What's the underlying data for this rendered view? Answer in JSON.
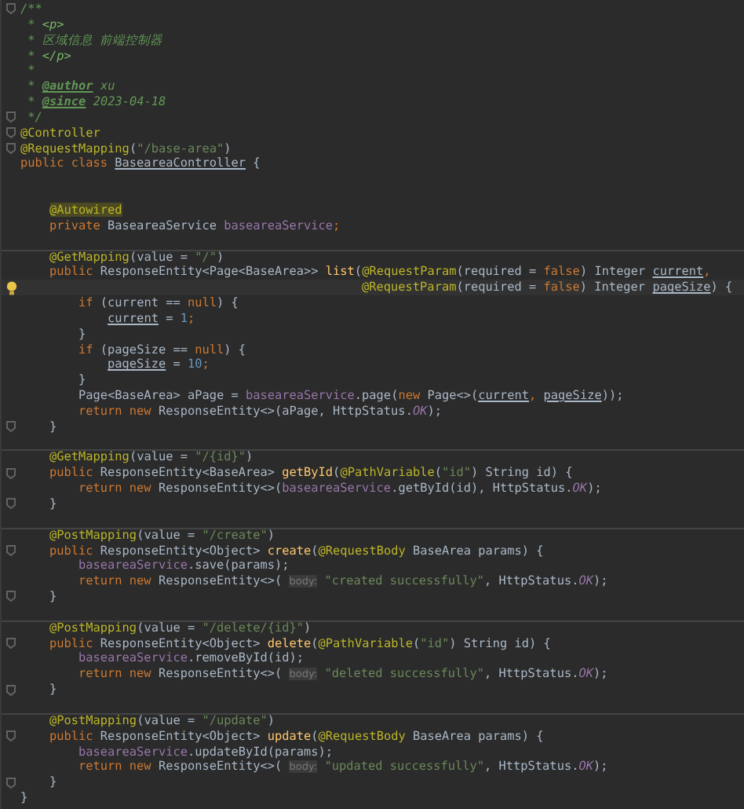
{
  "editor": {
    "lines": [
      {
        "kind": "code",
        "fold_marker": true,
        "tokens": [
          {
            "kind": "doc",
            "text": "/**"
          }
        ]
      },
      {
        "kind": "code",
        "tokens": [
          {
            "kind": "doc",
            "text": " * "
          },
          {
            "kind": "doc-html",
            "text": "<p>"
          }
        ]
      },
      {
        "kind": "code",
        "tokens": [
          {
            "kind": "doc",
            "text": " * 区域信息 前端控制器"
          }
        ]
      },
      {
        "kind": "code",
        "tokens": [
          {
            "kind": "doc",
            "text": " * "
          },
          {
            "kind": "doc-html",
            "text": "</p>"
          }
        ]
      },
      {
        "kind": "code",
        "tokens": [
          {
            "kind": "doc",
            "text": " *"
          }
        ]
      },
      {
        "kind": "code",
        "tokens": [
          {
            "kind": "doc",
            "text": " * "
          },
          {
            "kind": "doc-tag",
            "text": "@author"
          },
          {
            "kind": "doc",
            "text": " xu"
          }
        ]
      },
      {
        "kind": "code",
        "tokens": [
          {
            "kind": "doc",
            "text": " * "
          },
          {
            "kind": "doc-tag",
            "text": "@since"
          },
          {
            "kind": "doc",
            "text": " 2023-04-18"
          }
        ]
      },
      {
        "kind": "code",
        "fold_marker": true,
        "tokens": [
          {
            "kind": "doc",
            "text": " */"
          }
        ]
      },
      {
        "kind": "code",
        "fold_marker": true,
        "tokens": [
          {
            "kind": "ann",
            "text": "@Controller"
          }
        ]
      },
      {
        "kind": "code",
        "fold_marker": true,
        "tokens": [
          {
            "kind": "ann",
            "text": "@RequestMapping"
          },
          {
            "kind": "plain",
            "text": "("
          },
          {
            "kind": "str",
            "text": "\"/base-area\""
          },
          {
            "kind": "plain",
            "text": ")"
          }
        ]
      },
      {
        "kind": "code",
        "tokens": [
          {
            "kind": "kw",
            "text": "public class "
          },
          {
            "kind": "under",
            "text": "BaseareaController"
          },
          {
            "kind": "plain",
            "text": " {"
          }
        ]
      },
      {
        "kind": "blank"
      },
      {
        "kind": "blank"
      },
      {
        "kind": "code",
        "tokens": [
          {
            "kind": "ann-marked",
            "text": "    @Autowired"
          }
        ]
      },
      {
        "kind": "code",
        "tokens": [
          {
            "kind": "kw",
            "text": "    private "
          },
          {
            "kind": "plain",
            "text": "BaseareaService "
          },
          {
            "kind": "field",
            "text": "baseareaService"
          },
          {
            "kind": "kw",
            "text": ";"
          }
        ]
      },
      {
        "kind": "blank"
      },
      {
        "kind": "code",
        "separator": true,
        "tokens": [
          {
            "kind": "ann",
            "text": "    @GetMapping"
          },
          {
            "kind": "plain",
            "text": "(value = "
          },
          {
            "kind": "str",
            "text": "\"/\""
          },
          {
            "kind": "plain",
            "text": ")"
          }
        ]
      },
      {
        "kind": "code",
        "tokens": [
          {
            "kind": "kw",
            "text": "    public "
          },
          {
            "kind": "plain",
            "text": "ResponseEntity<Page<BaseArea>> "
          },
          {
            "kind": "method",
            "text": "list"
          },
          {
            "kind": "plain",
            "text": "("
          },
          {
            "kind": "ann",
            "text": "@RequestParam"
          },
          {
            "kind": "plain",
            "text": "(required = "
          },
          {
            "kind": "kw",
            "text": "false"
          },
          {
            "kind": "plain",
            "text": ") Integer "
          },
          {
            "kind": "under",
            "text": "current"
          },
          {
            "kind": "kw",
            "text": ","
          }
        ]
      },
      {
        "kind": "code",
        "bulb": true,
        "highlighted": true,
        "tokens": [
          {
            "kind": "ann",
            "text": "                                               @RequestParam"
          },
          {
            "kind": "plain",
            "text": "(required = "
          },
          {
            "kind": "kw",
            "text": "false"
          },
          {
            "kind": "plain",
            "text": ") Integer "
          },
          {
            "kind": "under",
            "text": "pageSize"
          },
          {
            "kind": "plain",
            "text": ") {"
          }
        ]
      },
      {
        "kind": "code",
        "tokens": [
          {
            "kind": "kw",
            "text": "        if "
          },
          {
            "kind": "plain",
            "text": "(current == "
          },
          {
            "kind": "kw",
            "text": "null"
          },
          {
            "kind": "plain",
            "text": ") {"
          }
        ]
      },
      {
        "kind": "code",
        "tokens": [
          {
            "kind": "under",
            "text": "            current"
          },
          {
            "kind": "plain",
            "text": " = "
          },
          {
            "kind": "num",
            "text": "1"
          },
          {
            "kind": "kw",
            "text": ";"
          }
        ]
      },
      {
        "kind": "code",
        "tokens": [
          {
            "kind": "plain",
            "text": "        }"
          }
        ]
      },
      {
        "kind": "code",
        "tokens": [
          {
            "kind": "kw",
            "text": "        if "
          },
          {
            "kind": "plain",
            "text": "(pageSize == "
          },
          {
            "kind": "kw",
            "text": "null"
          },
          {
            "kind": "plain",
            "text": ") {"
          }
        ]
      },
      {
        "kind": "code",
        "tokens": [
          {
            "kind": "under",
            "text": "            pageSize"
          },
          {
            "kind": "plain",
            "text": " = "
          },
          {
            "kind": "num",
            "text": "10"
          },
          {
            "kind": "kw",
            "text": ";"
          }
        ]
      },
      {
        "kind": "code",
        "tokens": [
          {
            "kind": "plain",
            "text": "        }"
          }
        ]
      },
      {
        "kind": "code",
        "tokens": [
          {
            "kind": "plain",
            "text": "        Page<BaseArea> aPage = "
          },
          {
            "kind": "field",
            "text": "baseareaService"
          },
          {
            "kind": "plain",
            "text": ".page("
          },
          {
            "kind": "kw",
            "text": "new "
          },
          {
            "kind": "plain",
            "text": "Page<>("
          },
          {
            "kind": "under",
            "text": "current"
          },
          {
            "kind": "kw",
            "text": ", "
          },
          {
            "kind": "under",
            "text": "pageSize"
          },
          {
            "kind": "plain",
            "text": "));"
          }
        ]
      },
      {
        "kind": "code",
        "tokens": [
          {
            "kind": "kw",
            "text": "        return new "
          },
          {
            "kind": "plain",
            "text": "ResponseEntity<>(aPage, HttpStatus."
          },
          {
            "kind": "static",
            "text": "OK"
          },
          {
            "kind": "plain",
            "text": ");"
          }
        ]
      },
      {
        "kind": "code",
        "fold_marker": true,
        "tokens": [
          {
            "kind": "plain",
            "text": "    }"
          }
        ]
      },
      {
        "kind": "blank"
      },
      {
        "kind": "code",
        "separator": true,
        "tokens": [
          {
            "kind": "ann",
            "text": "    @GetMapping"
          },
          {
            "kind": "plain",
            "text": "(value = "
          },
          {
            "kind": "str",
            "text": "\"/{id}\""
          },
          {
            "kind": "plain",
            "text": ")"
          }
        ]
      },
      {
        "kind": "code",
        "fold_marker": true,
        "tokens": [
          {
            "kind": "kw",
            "text": "    public "
          },
          {
            "kind": "plain",
            "text": "ResponseEntity<BaseArea> "
          },
          {
            "kind": "method",
            "text": "getById"
          },
          {
            "kind": "plain",
            "text": "("
          },
          {
            "kind": "ann",
            "text": "@PathVariable"
          },
          {
            "kind": "plain",
            "text": "("
          },
          {
            "kind": "str",
            "text": "\"id\""
          },
          {
            "kind": "plain",
            "text": ") String id) {"
          }
        ]
      },
      {
        "kind": "code",
        "tokens": [
          {
            "kind": "kw",
            "text": "        return new "
          },
          {
            "kind": "plain",
            "text": "ResponseEntity<>("
          },
          {
            "kind": "field",
            "text": "baseareaService"
          },
          {
            "kind": "plain",
            "text": ".getById(id), HttpStatus."
          },
          {
            "kind": "static",
            "text": "OK"
          },
          {
            "kind": "plain",
            "text": ");"
          }
        ]
      },
      {
        "kind": "code",
        "fold_marker": true,
        "tokens": [
          {
            "kind": "plain",
            "text": "    }"
          }
        ]
      },
      {
        "kind": "blank"
      },
      {
        "kind": "code",
        "separator": true,
        "tokens": [
          {
            "kind": "ann",
            "text": "    @PostMapping"
          },
          {
            "kind": "plain",
            "text": "(value = "
          },
          {
            "kind": "str",
            "text": "\"/create\""
          },
          {
            "kind": "plain",
            "text": ")"
          }
        ]
      },
      {
        "kind": "code",
        "fold_marker": true,
        "tokens": [
          {
            "kind": "kw",
            "text": "    public "
          },
          {
            "kind": "plain",
            "text": "ResponseEntity<Object> "
          },
          {
            "kind": "method",
            "text": "create"
          },
          {
            "kind": "plain",
            "text": "("
          },
          {
            "kind": "ann",
            "text": "@RequestBody"
          },
          {
            "kind": "plain",
            "text": " BaseArea params) {"
          }
        ]
      },
      {
        "kind": "code",
        "tokens": [
          {
            "kind": "field",
            "text": "        baseareaService"
          },
          {
            "kind": "plain",
            "text": ".save(params);"
          }
        ]
      },
      {
        "kind": "code",
        "tokens": [
          {
            "kind": "kw",
            "text": "        return new "
          },
          {
            "kind": "plain",
            "text": "ResponseEntity<>( "
          },
          {
            "kind": "hint",
            "text": "body:"
          },
          {
            "kind": "str",
            "text": " \"created successfully\""
          },
          {
            "kind": "plain",
            "text": ", HttpStatus."
          },
          {
            "kind": "static",
            "text": "OK"
          },
          {
            "kind": "plain",
            "text": ");"
          }
        ]
      },
      {
        "kind": "code",
        "fold_marker": true,
        "tokens": [
          {
            "kind": "plain",
            "text": "    }"
          }
        ]
      },
      {
        "kind": "blank"
      },
      {
        "kind": "code",
        "separator": true,
        "tokens": [
          {
            "kind": "ann",
            "text": "    @PostMapping"
          },
          {
            "kind": "plain",
            "text": "(value = "
          },
          {
            "kind": "str",
            "text": "\"/delete/{id}\""
          },
          {
            "kind": "plain",
            "text": ")"
          }
        ]
      },
      {
        "kind": "code",
        "fold_marker": true,
        "tokens": [
          {
            "kind": "kw",
            "text": "    public "
          },
          {
            "kind": "plain",
            "text": "ResponseEntity<Object> "
          },
          {
            "kind": "method",
            "text": "delete"
          },
          {
            "kind": "plain",
            "text": "("
          },
          {
            "kind": "ann",
            "text": "@PathVariable"
          },
          {
            "kind": "plain",
            "text": "("
          },
          {
            "kind": "str",
            "text": "\"id\""
          },
          {
            "kind": "plain",
            "text": ") String id) {"
          }
        ]
      },
      {
        "kind": "code",
        "tokens": [
          {
            "kind": "field",
            "text": "        baseareaService"
          },
          {
            "kind": "plain",
            "text": ".removeById(id);"
          }
        ]
      },
      {
        "kind": "code",
        "tokens": [
          {
            "kind": "kw",
            "text": "        return new "
          },
          {
            "kind": "plain",
            "text": "ResponseEntity<>( "
          },
          {
            "kind": "hint",
            "text": "body:"
          },
          {
            "kind": "str",
            "text": " \"deleted successfully\""
          },
          {
            "kind": "plain",
            "text": ", HttpStatus."
          },
          {
            "kind": "static",
            "text": "OK"
          },
          {
            "kind": "plain",
            "text": ");"
          }
        ]
      },
      {
        "kind": "code",
        "fold_marker": true,
        "tokens": [
          {
            "kind": "plain",
            "text": "    }"
          }
        ]
      },
      {
        "kind": "blank"
      },
      {
        "kind": "code",
        "separator": true,
        "tokens": [
          {
            "kind": "ann",
            "text": "    @PostMapping"
          },
          {
            "kind": "plain",
            "text": "(value = "
          },
          {
            "kind": "str",
            "text": "\"/update\""
          },
          {
            "kind": "plain",
            "text": ")"
          }
        ]
      },
      {
        "kind": "code",
        "fold_marker": true,
        "tokens": [
          {
            "kind": "kw",
            "text": "    public "
          },
          {
            "kind": "plain",
            "text": "ResponseEntity<Object> "
          },
          {
            "kind": "method",
            "text": "update"
          },
          {
            "kind": "plain",
            "text": "("
          },
          {
            "kind": "ann",
            "text": "@RequestBody"
          },
          {
            "kind": "plain",
            "text": " BaseArea params) {"
          }
        ]
      },
      {
        "kind": "code",
        "tokens": [
          {
            "kind": "field",
            "text": "        baseareaService"
          },
          {
            "kind": "plain",
            "text": ".updateById(params);"
          }
        ]
      },
      {
        "kind": "code",
        "tokens": [
          {
            "kind": "kw",
            "text": "        return new "
          },
          {
            "kind": "plain",
            "text": "ResponseEntity<>( "
          },
          {
            "kind": "hint",
            "text": "body:"
          },
          {
            "kind": "str",
            "text": " \"updated successfully\""
          },
          {
            "kind": "plain",
            "text": ", HttpStatus."
          },
          {
            "kind": "static",
            "text": "OK"
          },
          {
            "kind": "plain",
            "text": ");"
          }
        ]
      },
      {
        "kind": "code",
        "fold_marker": true,
        "tokens": [
          {
            "kind": "plain",
            "text": "    }"
          }
        ]
      },
      {
        "kind": "code",
        "tokens": [
          {
            "kind": "plain",
            "text": "}"
          }
        ]
      }
    ]
  }
}
